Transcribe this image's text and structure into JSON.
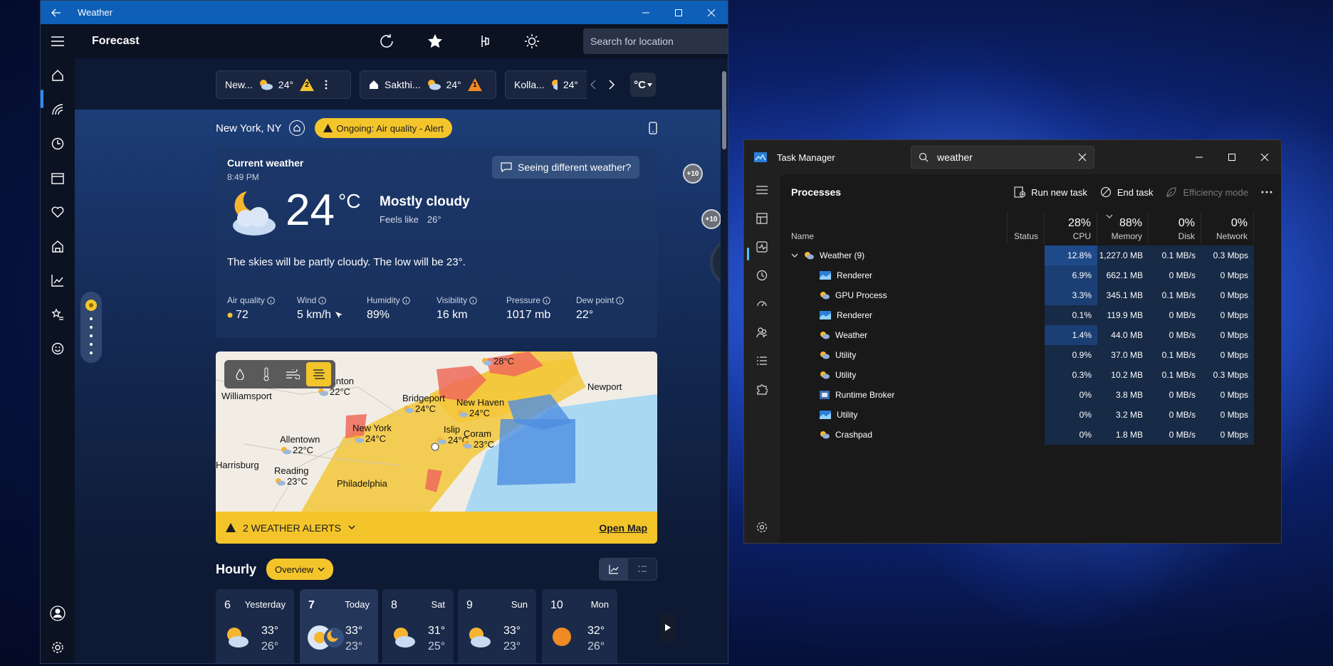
{
  "weather_app": {
    "window_title": "Weather",
    "toolbar": {
      "page_title": "Forecast",
      "search_placeholder": "Search for location"
    },
    "location_chips": [
      {
        "name": "New...",
        "temp": "24°",
        "alert_count": "2"
      },
      {
        "name": "Sakthi...",
        "temp": "24°",
        "alert_count": "1"
      },
      {
        "name": "Kolla...",
        "temp": "24°"
      }
    ],
    "unit": "°C",
    "location": "New York, NY",
    "alert_pill": "Ongoing: Air quality - Alert",
    "current": {
      "label": "Current weather",
      "time": "8:49 PM",
      "temp": "24",
      "unit": "°C",
      "condition": "Mostly cloudy",
      "feels_like_label": "Feels like",
      "feels_like": "26°",
      "seeing_different": "Seeing different weather?",
      "summary": "The skies will be partly cloudy. The low will be 23°."
    },
    "metrics": [
      {
        "label": "Air quality",
        "value": "72"
      },
      {
        "label": "Wind",
        "value": "5 km/h"
      },
      {
        "label": "Humidity",
        "value": "89%"
      },
      {
        "label": "Visibility",
        "value": "16 km"
      },
      {
        "label": "Pressure",
        "value": "1017 mb"
      },
      {
        "label": "Dew point",
        "value": "22°"
      }
    ],
    "map": {
      "labels": [
        {
          "text": "Scranton",
          "temp": "22°C"
        },
        {
          "text": "Williamsport",
          "temp": ""
        },
        {
          "text": "Bridgeport",
          "temp": "24°C"
        },
        {
          "text": "New Haven",
          "temp": "24°C"
        },
        {
          "text": "Newport",
          "temp": ""
        },
        {
          "text": "Allentown",
          "temp": "22°C"
        },
        {
          "text": "New York",
          "temp": "24°C"
        },
        {
          "text": "Islip",
          "temp": "24°C"
        },
        {
          "text": "Coram",
          "temp": "23°C"
        },
        {
          "text": "Reading",
          "temp": "23°C"
        },
        {
          "text": "Philadelphia",
          "temp": ""
        },
        {
          "text": "Harrisburg",
          "temp": ""
        },
        {
          "text": "",
          "temp": "28°C"
        }
      ],
      "alerts_text": "2 WEATHER ALERTS",
      "open_map": "Open Map"
    },
    "hourly": {
      "title": "Hourly",
      "overview_label": "Overview",
      "days": [
        {
          "num": "6",
          "label": "Yesterday",
          "hi": "33°",
          "lo": "26°"
        },
        {
          "num": "7",
          "label": "Today",
          "hi": "33°",
          "lo": "23°"
        },
        {
          "num": "8",
          "label": "Sat",
          "hi": "31°",
          "lo": "25°"
        },
        {
          "num": "9",
          "label": "Sun",
          "hi": "33°",
          "lo": "23°"
        },
        {
          "num": "10",
          "label": "Mon",
          "hi": "32°",
          "lo": "26°"
        }
      ]
    },
    "badge": "+10"
  },
  "task_manager": {
    "window_title": "Task Manager",
    "search_value": "weather",
    "section_title": "Processes",
    "actions": {
      "run_new_task": "Run new task",
      "end_task": "End task",
      "efficiency_mode": "Efficiency mode"
    },
    "columns": {
      "name": "Name",
      "status": "Status",
      "cpu": {
        "pct": "28%",
        "label": "CPU"
      },
      "memory": {
        "pct": "88%",
        "label": "Memory"
      },
      "disk": {
        "pct": "0%",
        "label": "Disk"
      },
      "network": {
        "pct": "0%",
        "label": "Network"
      }
    },
    "rows": [
      {
        "name": "Weather (9)",
        "cpu": "12.8%",
        "memory": "1,227.0 MB",
        "disk": "0.1 MB/s",
        "network": "0.3 Mbps",
        "icon": "weather-icon"
      },
      {
        "name": "Renderer",
        "cpu": "6.9%",
        "memory": "662.1 MB",
        "disk": "0 MB/s",
        "network": "0 Mbps",
        "icon": "renderer-icon"
      },
      {
        "name": "GPU Process",
        "cpu": "3.3%",
        "memory": "345.1 MB",
        "disk": "0.1 MB/s",
        "network": "0 Mbps",
        "icon": "weather-icon"
      },
      {
        "name": "Renderer",
        "cpu": "0.1%",
        "memory": "119.9 MB",
        "disk": "0 MB/s",
        "network": "0 Mbps",
        "icon": "renderer-icon"
      },
      {
        "name": "Weather",
        "cpu": "1.4%",
        "memory": "44.0 MB",
        "disk": "0 MB/s",
        "network": "0 Mbps",
        "icon": "weather-icon"
      },
      {
        "name": "Utility",
        "cpu": "0.9%",
        "memory": "37.0 MB",
        "disk": "0.1 MB/s",
        "network": "0 Mbps",
        "icon": "weather-icon"
      },
      {
        "name": "Utility",
        "cpu": "0.3%",
        "memory": "10.2 MB",
        "disk": "0.1 MB/s",
        "network": "0.3 Mbps",
        "icon": "weather-icon"
      },
      {
        "name": "Runtime Broker",
        "cpu": "0%",
        "memory": "3.8 MB",
        "disk": "0 MB/s",
        "network": "0 Mbps",
        "icon": "broker-icon"
      },
      {
        "name": "Utility",
        "cpu": "0%",
        "memory": "3.2 MB",
        "disk": "0 MB/s",
        "network": "0 Mbps",
        "icon": "renderer-icon"
      },
      {
        "name": "Crashpad",
        "cpu": "0%",
        "memory": "1.8 MB",
        "disk": "0 MB/s",
        "network": "0 Mbps",
        "icon": "weather-icon"
      }
    ]
  },
  "colors": {
    "accent": "#0d5fb8",
    "alert_yellow": "#f4c52b",
    "tm_accent": "#4cc2ff"
  }
}
